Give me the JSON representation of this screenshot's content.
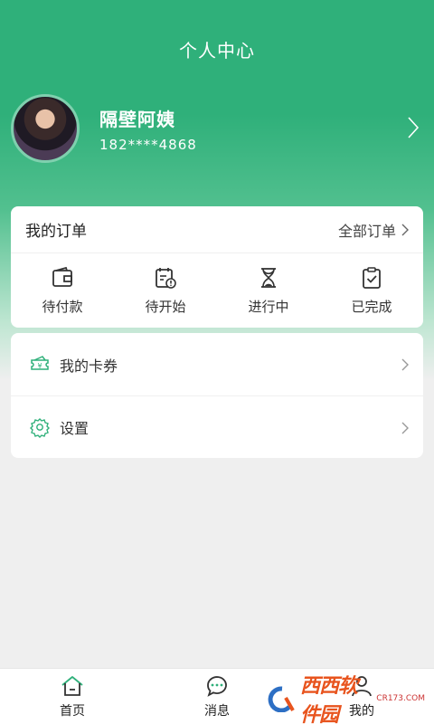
{
  "header": {
    "title": "个人中心"
  },
  "profile": {
    "name": "隔壁阿姨",
    "phone": "182****4868"
  },
  "orders": {
    "title": "我的订单",
    "all_label": "全部订单",
    "items": [
      {
        "label": "待付款",
        "icon": "wallet-icon"
      },
      {
        "label": "待开始",
        "icon": "calendar-clock-icon"
      },
      {
        "label": "进行中",
        "icon": "hourglass-icon"
      },
      {
        "label": "已完成",
        "icon": "clipboard-check-icon"
      }
    ]
  },
  "menu": {
    "items": [
      {
        "label": "我的卡券",
        "icon": "coupon-icon"
      },
      {
        "label": "设置",
        "icon": "gear-icon"
      }
    ]
  },
  "tabbar": {
    "items": [
      {
        "label": "首页",
        "icon": "home-icon"
      },
      {
        "label": "消息",
        "icon": "chat-bubble-icon"
      },
      {
        "label": "我的",
        "icon": "user-icon"
      }
    ]
  },
  "watermark": {
    "brand": "西西软件园",
    "url": "CR173.COM"
  },
  "colors": {
    "accent": "#2fb07a",
    "icon": "#333333",
    "watermark": "#e8541e"
  }
}
